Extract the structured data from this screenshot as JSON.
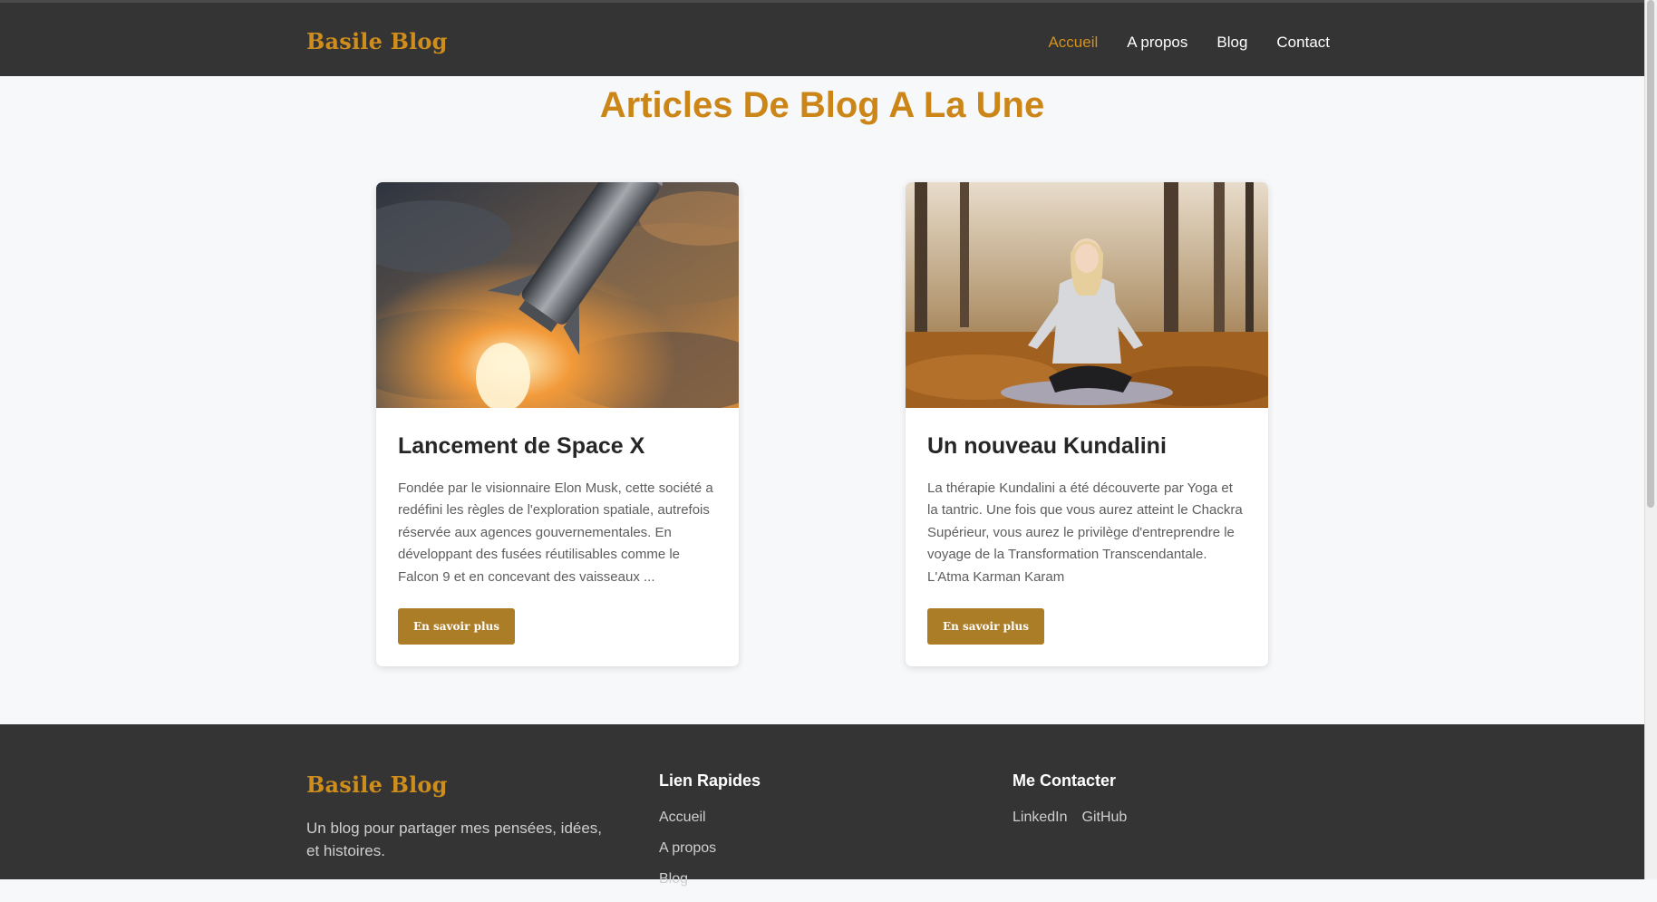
{
  "header": {
    "logo": "Basile Blog",
    "nav": [
      "Accueil",
      "A propos",
      "Blog",
      "Contact"
    ],
    "active_nav": "Accueil"
  },
  "main": {
    "title": "Articles De Blog A La Une",
    "cards": [
      {
        "title": "Lancement de Space X",
        "excerpt": "Fondée par le visionnaire Elon Musk, cette société a redéfini les règles de l'exploration spatiale, autrefois réservée aux agences gouvernementales. En développant des fusées réutilisables comme le Falcon 9 et en concevant des vaisseaux ...",
        "button": "En savoir plus"
      },
      {
        "title": "Un nouveau Kundalini",
        "excerpt": "La thérapie Kundalini a été découverte par Yoga et la tantric. Une fois que vous aurez atteint le Chackra Supérieur, vous aurez le privilège d'entreprendre le voyage de la Transformation Transcendantale. L'Atma Karman Karam",
        "button": "En savoir plus"
      }
    ]
  },
  "footer": {
    "logo": "Basile Blog",
    "tagline": "Un blog pour partager mes pensées, idées, et histoires.",
    "quick_links_title": "Lien Rapides",
    "quick_links": [
      "Accueil",
      "A propos",
      "Blog"
    ],
    "contact_title": "Me Contacter",
    "contact_links": [
      "LinkedIn",
      "GitHub"
    ]
  },
  "colors": {
    "accent": "#cc8617",
    "button": "#ab7d27",
    "dark": "#343434"
  }
}
